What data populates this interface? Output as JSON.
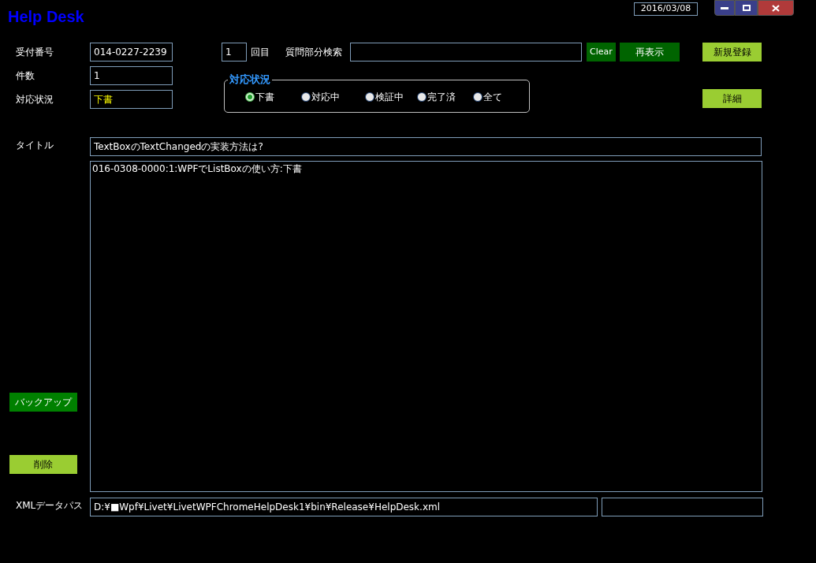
{
  "window": {
    "title": "Help Desk",
    "date": "2016/03/08"
  },
  "fields": [
    {
      "label": "受付番号",
      "value": "014-0227-2239",
      "highlight": false
    },
    {
      "label": "件数",
      "value": "1",
      "highlight": false
    },
    {
      "label": "対応状況",
      "value": "下書",
      "highlight": true
    }
  ],
  "search": {
    "count": "1",
    "count_suffix": "回目",
    "label": "質問部分検索",
    "clear_button": "Clear",
    "refresh_button": "再表示"
  },
  "status_group": {
    "legend": "対応状況",
    "options": [
      {
        "label": "下書",
        "selected": true
      },
      {
        "label": "対応中",
        "selected": false
      },
      {
        "label": "検証中",
        "selected": false
      },
      {
        "label": "完了済",
        "selected": false
      },
      {
        "label": "全て",
        "selected": false
      }
    ]
  },
  "right_buttons": [
    "新規登録",
    "詳細"
  ],
  "title_field": {
    "label": "タイトル",
    "value": "TextBoxのTextChangedの実装方法は?"
  },
  "list_items": [
    "016-0308-0000:1:WPFでListBoxの使い方:下書"
  ],
  "left_buttons": [
    {
      "label": "バックアップ",
      "kind": "dark"
    },
    {
      "label": "削除",
      "kind": "light"
    }
  ],
  "xml_path": {
    "label": "XMLデータパス",
    "value": "D:¥■Wpf¥Livet¥LivetWPFChromeHelpDesk1¥bin¥Release¥HelpDesk.xml"
  }
}
